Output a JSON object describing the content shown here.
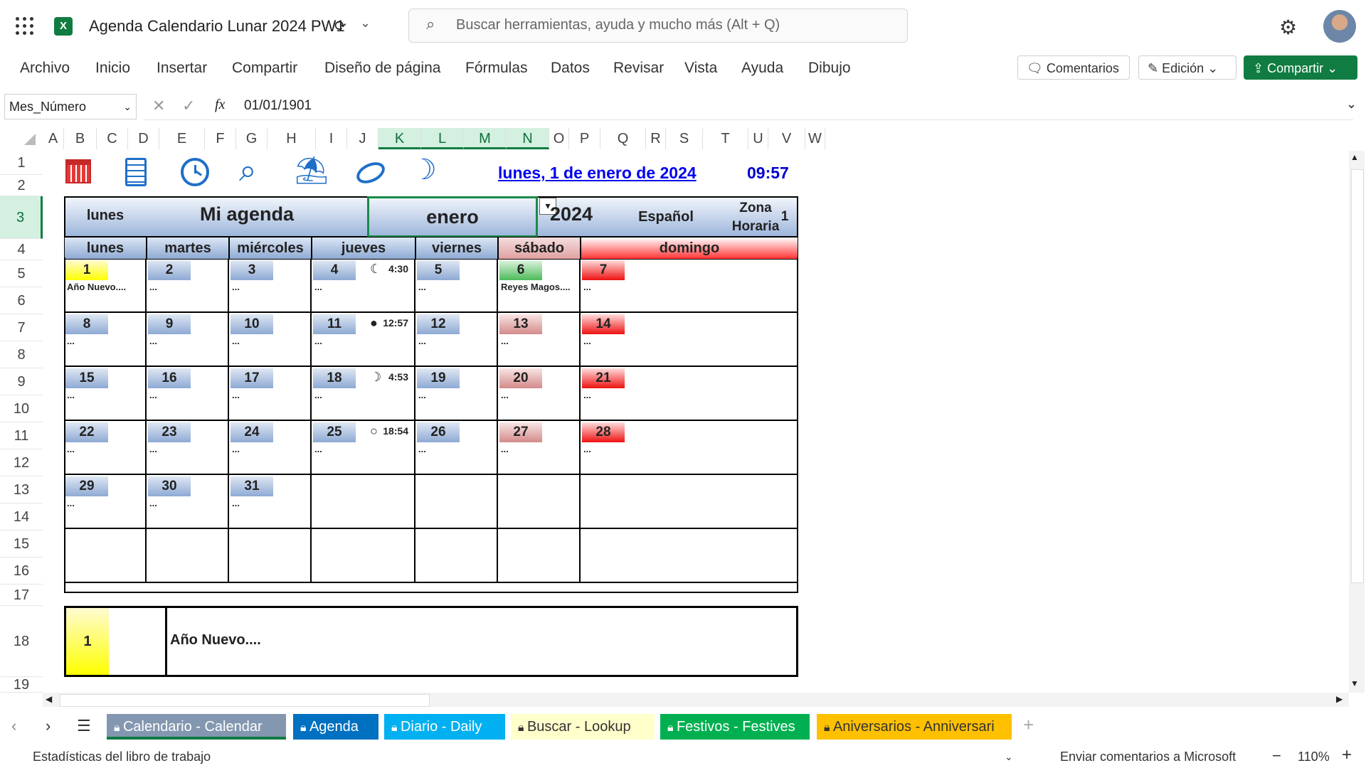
{
  "app": {
    "title": "Agenda Calendario Lunar 2024 PW1",
    "search_placeholder": "Buscar herramientas, ayuda y mucho más (Alt + Q)"
  },
  "ribbon": {
    "menu": [
      "Archivo",
      "Inicio",
      "Insertar",
      "Compartir",
      "Diseño de página",
      "Fórmulas",
      "Datos",
      "Revisar",
      "Vista",
      "Ayuda",
      "Dibujo"
    ],
    "comments_label": "Comentarios",
    "edit_label": "Edición",
    "share_label": "Compartir"
  },
  "formula_bar": {
    "name_box": "Mes_Número",
    "fx": "fx",
    "value": "01/01/1901"
  },
  "columns": [
    "A",
    "B",
    "C",
    "D",
    "E",
    "F",
    "G",
    "H",
    "I",
    "J",
    "K",
    "L",
    "M",
    "N",
    "O",
    "P",
    "Q",
    "R",
    "S",
    "T",
    "U",
    "V",
    "W"
  ],
  "rows": [
    "1",
    "2",
    "3",
    "4",
    "5",
    "6",
    "7",
    "8",
    "9",
    "10",
    "11",
    "12",
    "13",
    "14",
    "15",
    "16",
    "17",
    "18",
    "19"
  ],
  "calendar": {
    "date_link": "lunes, 1 de enero de 2024",
    "time": "09:57",
    "header": {
      "weekday": "lunes",
      "agenda": "Mi agenda",
      "month": "enero",
      "year": "2024",
      "language": "Español",
      "zone_label": "Zona Horaria",
      "zone_value": "1"
    },
    "weekdays": [
      "lunes",
      "martes",
      "miércoles",
      "jueves",
      "viernes",
      "sábado",
      "domingo"
    ],
    "weeks": [
      [
        {
          "d": "1",
          "t": "Año Nuevo....",
          "c": "yel"
        },
        {
          "d": "2",
          "t": "..."
        },
        {
          "d": "3",
          "t": "..."
        },
        {
          "d": "4",
          "t": "..."
        },
        {
          "d": "5",
          "t": "..."
        },
        {
          "d": "6",
          "t": "Reyes Magos....",
          "c": "grn"
        },
        {
          "d": "7",
          "t": "...",
          "c": "sun"
        }
      ],
      [
        {
          "d": "8",
          "t": "..."
        },
        {
          "d": "9",
          "t": "..."
        },
        {
          "d": "10",
          "t": "..."
        },
        {
          "d": "11",
          "t": "..."
        },
        {
          "d": "12",
          "t": "..."
        },
        {
          "d": "13",
          "t": "...",
          "c": "sat"
        },
        {
          "d": "14",
          "t": "...",
          "c": "sun"
        }
      ],
      [
        {
          "d": "15",
          "t": "..."
        },
        {
          "d": "16",
          "t": "..."
        },
        {
          "d": "17",
          "t": "..."
        },
        {
          "d": "18",
          "t": "..."
        },
        {
          "d": "19",
          "t": "..."
        },
        {
          "d": "20",
          "t": "...",
          "c": "sat"
        },
        {
          "d": "21",
          "t": "...",
          "c": "sun"
        }
      ],
      [
        {
          "d": "22",
          "t": "..."
        },
        {
          "d": "23",
          "t": "..."
        },
        {
          "d": "24",
          "t": "..."
        },
        {
          "d": "25",
          "t": "..."
        },
        {
          "d": "26",
          "t": "..."
        },
        {
          "d": "27",
          "t": "...",
          "c": "sat"
        },
        {
          "d": "28",
          "t": "...",
          "c": "sun"
        }
      ],
      [
        {
          "d": "29",
          "t": "..."
        },
        {
          "d": "30",
          "t": "..."
        },
        {
          "d": "31",
          "t": "..."
        },
        {
          "d": "",
          "t": ""
        },
        {
          "d": "",
          "t": ""
        },
        {
          "d": "",
          "t": ""
        },
        {
          "d": "",
          "t": ""
        }
      ],
      [
        {
          "d": "",
          "t": ""
        },
        {
          "d": "",
          "t": ""
        },
        {
          "d": "",
          "t": ""
        },
        {
          "d": "",
          "t": ""
        },
        {
          "d": "",
          "t": ""
        },
        {
          "d": "",
          "t": ""
        },
        {
          "d": "",
          "t": ""
        }
      ]
    ],
    "moon_phases": [
      {
        "symbol": "☾",
        "time": "4:30"
      },
      {
        "symbol": "●",
        "time": "12:57"
      },
      {
        "symbol": "☽",
        "time": "4:53"
      },
      {
        "symbol": "○",
        "time": "18:54"
      }
    ],
    "detail": {
      "day": "1",
      "text": "Año Nuevo...."
    }
  },
  "sheet_tabs": [
    {
      "label": "Calendario - Calendar",
      "bg": "#8497b0",
      "fg": "#ffffff"
    },
    {
      "label": "Agenda",
      "bg": "#0070c0",
      "fg": "#ffffff"
    },
    {
      "label": "Diario - Daily",
      "bg": "#00b0f0",
      "fg": "#ffffff"
    },
    {
      "label": "Buscar - Lookup",
      "bg": "#ffffcc",
      "fg": "#333333"
    },
    {
      "label": "Festivos - Festives",
      "bg": "#00b050",
      "fg": "#ffffff"
    },
    {
      "label": "Aniversarios - Anniversari",
      "bg": "#ffc000",
      "fg": "#333333"
    }
  ],
  "status": {
    "left": "Estadísticas del libro de trabajo",
    "feedback": "Enviar comentarios a Microsoft",
    "zoom": "110%"
  }
}
